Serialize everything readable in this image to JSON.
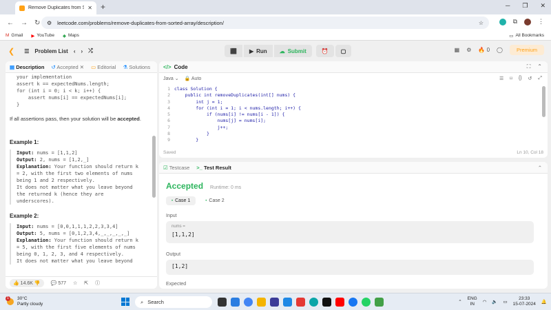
{
  "browser": {
    "tab_title": "Remove Duplicates from Sorte",
    "url": "leetcode.com/problems/remove-duplicates-from-sorted-array/description/",
    "bookmarks": [
      "Gmail",
      "YouTube",
      "Maps"
    ],
    "all_bookmarks": "All Bookmarks"
  },
  "lcnav": {
    "problem_list": "Problem List",
    "run": "Run",
    "submit": "Submit",
    "streak_count": "0",
    "premium": "Premium"
  },
  "left": {
    "tabs": [
      "Description",
      "Accepted",
      "Editorial",
      "Solutions"
    ],
    "code_lines": [
      "your implementation",
      "",
      "assert k == expectedNums.length;",
      "for (int i = 0; i < k; i++) {",
      "    assert nums[i] == expectedNums[i];",
      "}"
    ],
    "pass_text_before": "If all assertions pass, then your solution will be ",
    "pass_text_bold": "accepted",
    "pass_text_after": ".",
    "example1": {
      "title": "Example 1:",
      "input_label": "Input:",
      "input": "nums = [1,1,2]",
      "output_label": "Output:",
      "output": "2, nums = [1,2,_]",
      "explanation_label": "Explanation:",
      "explanation": [
        "Your function should return k",
        "= 2, with the first two elements of nums",
        "being 1 and 2 respectively.",
        "It does not matter what you leave beyond",
        "the returned k (hence they are",
        "underscores)."
      ]
    },
    "example2": {
      "title": "Example 2:",
      "input_label": "Input:",
      "input": "nums = [0,0,1,1,1,2,2,3,3,4]",
      "output_label": "Output:",
      "output": "5, nums = [0,1,2,3,4,_,_,_,_,_]",
      "explanation_label": "Explanation:",
      "explanation": [
        "Your function should return k",
        "= 5, with the first five elements of nums",
        "being 0, 1, 2, 3, and 4 respectively.",
        "It does not matter what you leave beyond"
      ]
    },
    "likes": "14.6K",
    "comments": "577"
  },
  "code": {
    "title": "Code",
    "language": "Java",
    "auto": "Auto",
    "lines": [
      {
        "n": "1",
        "t": "class Solution {"
      },
      {
        "n": "2",
        "t": "    public int removeDuplicates(int[] nums) {"
      },
      {
        "n": "3",
        "t": "        int j = 1;"
      },
      {
        "n": "4",
        "t": "        for (int i = 1; i < nums.length; i++) {"
      },
      {
        "n": "5",
        "t": "            if (nums[i] != nums[i - 1]) {"
      },
      {
        "n": "6",
        "t": "                nums[j] = nums[i];"
      },
      {
        "n": "7",
        "t": "                j++;"
      },
      {
        "n": "8",
        "t": "            }"
      },
      {
        "n": "9",
        "t": "        }"
      }
    ],
    "saved": "Saved",
    "cursor": "Ln 10, Col 18"
  },
  "result": {
    "tabs": [
      "Testcase",
      "Test Result"
    ],
    "status": "Accepted",
    "runtime": "Runtime: 0 ms",
    "cases": [
      "Case 1",
      "Case 2"
    ],
    "input_label": "Input",
    "input_var": "nums =",
    "input_value": "[1,1,2]",
    "output_label": "Output",
    "output_value": "[1,2]",
    "expected_label": "Expected"
  },
  "taskbar": {
    "temp": "30°C",
    "weather": "Partly cloudy",
    "weather_badge": "1",
    "search": "Search",
    "lang1": "ENG",
    "lang2": "IN",
    "time": "23:33",
    "date": "15-07-2024"
  },
  "colors": {
    "accent_orange": "#ffa116",
    "accepted_green": "#2db55d"
  }
}
